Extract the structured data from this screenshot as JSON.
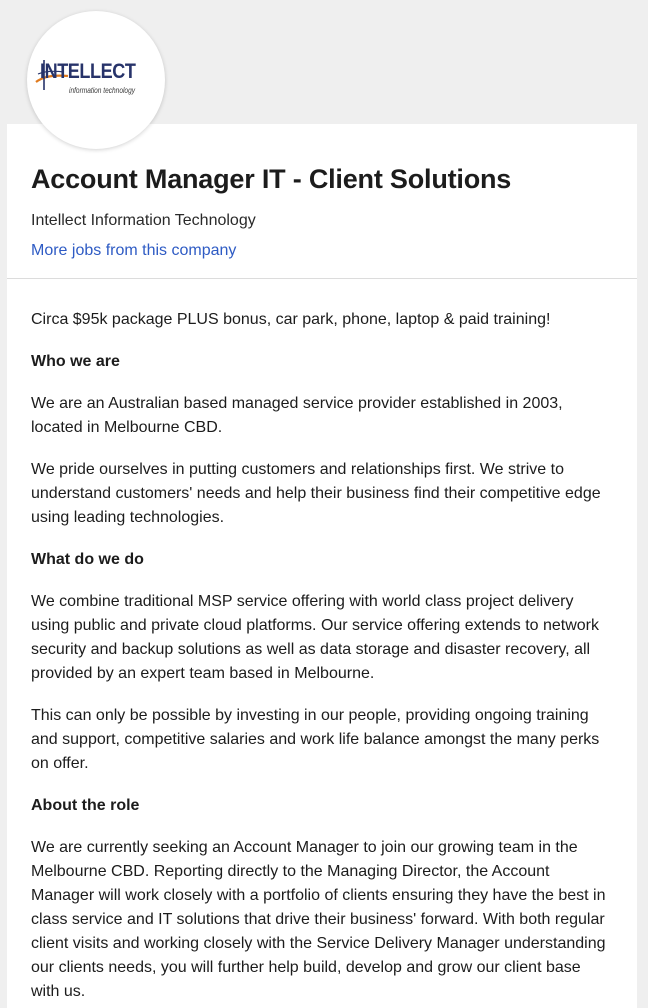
{
  "logo": {
    "brand": "INTELLECT",
    "subtitle": "information technology",
    "colors": {
      "navy": "#27336a",
      "orange": "#e07b1f"
    }
  },
  "job": {
    "title": "Account Manager IT - Client Solutions",
    "company": "Intellect Information Technology",
    "more_jobs_link": "More jobs from this company"
  },
  "description": {
    "p1": "Circa $95k package PLUS bonus, car park, phone, laptop & paid training!",
    "h1": "Who we are",
    "p2": "We are an Australian based managed service provider established in 2003, located in Melbourne CBD.",
    "p3": "We pride ourselves in putting customers and relationships first. We strive to understand customers' needs and help their business find their competitive edge using leading technologies.",
    "h2": "What do we do",
    "p4": "We combine traditional MSP service offering with world class project delivery using public and private cloud platforms. Our service offering extends to network security and backup solutions as well as data storage and disaster recovery, all provided by an expert team based in Melbourne.",
    "p5": "This can only be possible by investing in our people, providing ongoing training and support, competitive salaries and work life balance amongst the many perks on offer.",
    "h3": "About the role",
    "p6": "We are currently seeking an Account Manager to join our growing team in the Melbourne CBD. Reporting directly to the Managing Director, the Account Manager will work closely with a portfolio of clients ensuring they have the best in class service and IT solutions that drive their business' forward. With both regular client visits and working closely with the Service Delivery Manager understanding our clients needs, you will further help build, develop and grow our client base with us."
  }
}
